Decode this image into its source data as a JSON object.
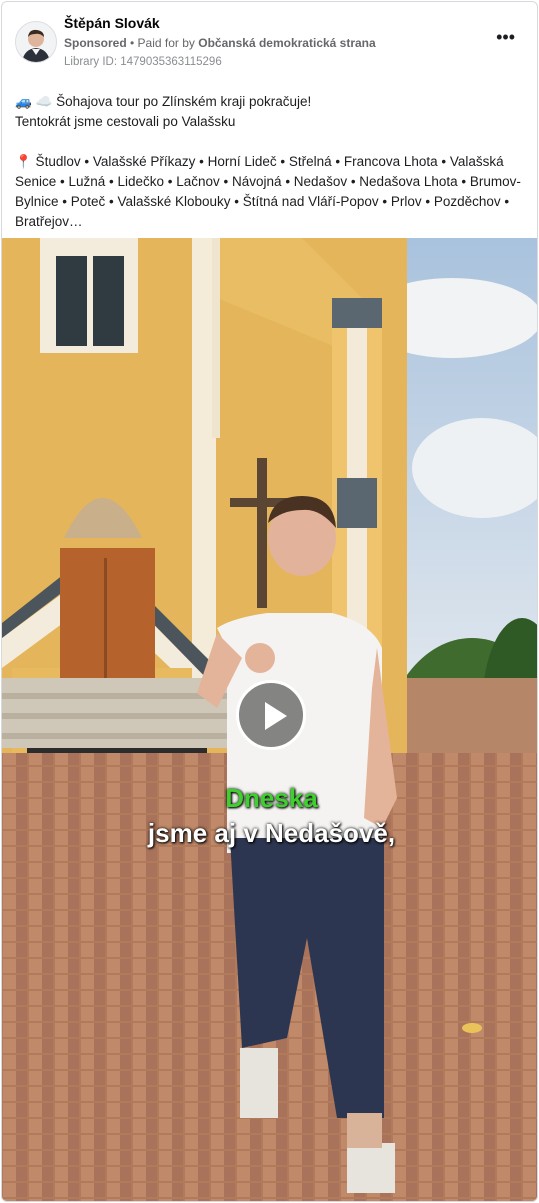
{
  "post": {
    "author": "Štěpán Slovák",
    "sponsored_label": "Sponsored",
    "paid_for_label": "• Paid for by",
    "payer": "Občanská demokratická strana",
    "library_id": "Library ID: 1479035363115296",
    "more_icon": "•••",
    "text_line1": "🚙 ☁️ Šohajova tour po Zlínském kraji pokračuje!",
    "text_line2": "Tentokrát jsme cestovali po Valašsku",
    "text_places": "📍 Študlov • Valašské Příkazy • Horní Lideč • Střelná • Francova Lhota • Valašská Senice • Lužná • Lidečko • Lačnov • Návojná • Nedašov • Nedašova Lhota • Brumov-Bylnice • Poteč • Valašské Klobouky • Štítná nad Vláří-Popov • Prlov • Pozděchov • Bratřejov…"
  },
  "video": {
    "caption_highlight": "Dneska",
    "caption_main": "jsme aj v Nedašově,",
    "play_icon": "play-icon"
  },
  "colors": {
    "caption_green": "#3ed12e",
    "meta_grey": "#65676b",
    "church_yellow": "#e6b85c",
    "door_brown": "#b5622c"
  }
}
